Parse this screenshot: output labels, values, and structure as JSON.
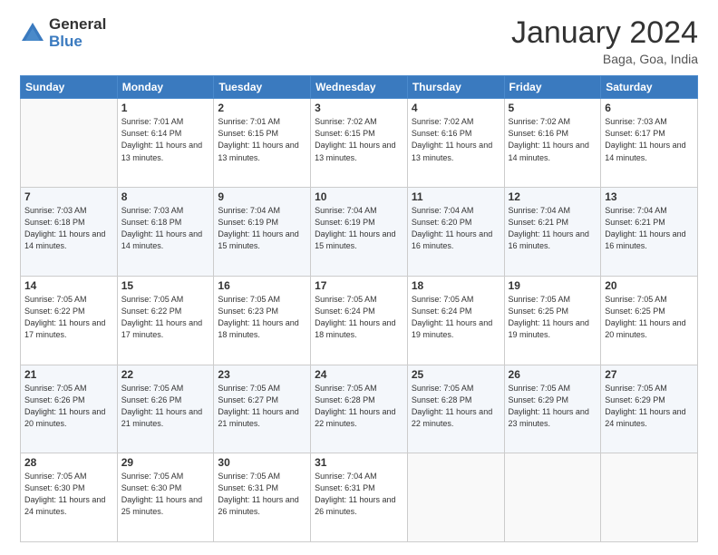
{
  "header": {
    "logo_general": "General",
    "logo_blue": "Blue",
    "month_title": "January 2024",
    "location": "Baga, Goa, India"
  },
  "days_of_week": [
    "Sunday",
    "Monday",
    "Tuesday",
    "Wednesday",
    "Thursday",
    "Friday",
    "Saturday"
  ],
  "weeks": [
    [
      {
        "day": "",
        "info": ""
      },
      {
        "day": "1",
        "info": "Sunrise: 7:01 AM\nSunset: 6:14 PM\nDaylight: 11 hours\nand 13 minutes."
      },
      {
        "day": "2",
        "info": "Sunrise: 7:01 AM\nSunset: 6:15 PM\nDaylight: 11 hours\nand 13 minutes."
      },
      {
        "day": "3",
        "info": "Sunrise: 7:02 AM\nSunset: 6:15 PM\nDaylight: 11 hours\nand 13 minutes."
      },
      {
        "day": "4",
        "info": "Sunrise: 7:02 AM\nSunset: 6:16 PM\nDaylight: 11 hours\nand 13 minutes."
      },
      {
        "day": "5",
        "info": "Sunrise: 7:02 AM\nSunset: 6:16 PM\nDaylight: 11 hours\nand 14 minutes."
      },
      {
        "day": "6",
        "info": "Sunrise: 7:03 AM\nSunset: 6:17 PM\nDaylight: 11 hours\nand 14 minutes."
      }
    ],
    [
      {
        "day": "7",
        "info": "Sunrise: 7:03 AM\nSunset: 6:18 PM\nDaylight: 11 hours\nand 14 minutes."
      },
      {
        "day": "8",
        "info": "Sunrise: 7:03 AM\nSunset: 6:18 PM\nDaylight: 11 hours\nand 14 minutes."
      },
      {
        "day": "9",
        "info": "Sunrise: 7:04 AM\nSunset: 6:19 PM\nDaylight: 11 hours\nand 15 minutes."
      },
      {
        "day": "10",
        "info": "Sunrise: 7:04 AM\nSunset: 6:19 PM\nDaylight: 11 hours\nand 15 minutes."
      },
      {
        "day": "11",
        "info": "Sunrise: 7:04 AM\nSunset: 6:20 PM\nDaylight: 11 hours\nand 16 minutes."
      },
      {
        "day": "12",
        "info": "Sunrise: 7:04 AM\nSunset: 6:21 PM\nDaylight: 11 hours\nand 16 minutes."
      },
      {
        "day": "13",
        "info": "Sunrise: 7:04 AM\nSunset: 6:21 PM\nDaylight: 11 hours\nand 16 minutes."
      }
    ],
    [
      {
        "day": "14",
        "info": "Sunrise: 7:05 AM\nSunset: 6:22 PM\nDaylight: 11 hours\nand 17 minutes."
      },
      {
        "day": "15",
        "info": "Sunrise: 7:05 AM\nSunset: 6:22 PM\nDaylight: 11 hours\nand 17 minutes."
      },
      {
        "day": "16",
        "info": "Sunrise: 7:05 AM\nSunset: 6:23 PM\nDaylight: 11 hours\nand 18 minutes."
      },
      {
        "day": "17",
        "info": "Sunrise: 7:05 AM\nSunset: 6:24 PM\nDaylight: 11 hours\nand 18 minutes."
      },
      {
        "day": "18",
        "info": "Sunrise: 7:05 AM\nSunset: 6:24 PM\nDaylight: 11 hours\nand 19 minutes."
      },
      {
        "day": "19",
        "info": "Sunrise: 7:05 AM\nSunset: 6:25 PM\nDaylight: 11 hours\nand 19 minutes."
      },
      {
        "day": "20",
        "info": "Sunrise: 7:05 AM\nSunset: 6:25 PM\nDaylight: 11 hours\nand 20 minutes."
      }
    ],
    [
      {
        "day": "21",
        "info": "Sunrise: 7:05 AM\nSunset: 6:26 PM\nDaylight: 11 hours\nand 20 minutes."
      },
      {
        "day": "22",
        "info": "Sunrise: 7:05 AM\nSunset: 6:26 PM\nDaylight: 11 hours\nand 21 minutes."
      },
      {
        "day": "23",
        "info": "Sunrise: 7:05 AM\nSunset: 6:27 PM\nDaylight: 11 hours\nand 21 minutes."
      },
      {
        "day": "24",
        "info": "Sunrise: 7:05 AM\nSunset: 6:28 PM\nDaylight: 11 hours\nand 22 minutes."
      },
      {
        "day": "25",
        "info": "Sunrise: 7:05 AM\nSunset: 6:28 PM\nDaylight: 11 hours\nand 22 minutes."
      },
      {
        "day": "26",
        "info": "Sunrise: 7:05 AM\nSunset: 6:29 PM\nDaylight: 11 hours\nand 23 minutes."
      },
      {
        "day": "27",
        "info": "Sunrise: 7:05 AM\nSunset: 6:29 PM\nDaylight: 11 hours\nand 24 minutes."
      }
    ],
    [
      {
        "day": "28",
        "info": "Sunrise: 7:05 AM\nSunset: 6:30 PM\nDaylight: 11 hours\nand 24 minutes."
      },
      {
        "day": "29",
        "info": "Sunrise: 7:05 AM\nSunset: 6:30 PM\nDaylight: 11 hours\nand 25 minutes."
      },
      {
        "day": "30",
        "info": "Sunrise: 7:05 AM\nSunset: 6:31 PM\nDaylight: 11 hours\nand 26 minutes."
      },
      {
        "day": "31",
        "info": "Sunrise: 7:04 AM\nSunset: 6:31 PM\nDaylight: 11 hours\nand 26 minutes."
      },
      {
        "day": "",
        "info": ""
      },
      {
        "day": "",
        "info": ""
      },
      {
        "day": "",
        "info": ""
      }
    ]
  ]
}
